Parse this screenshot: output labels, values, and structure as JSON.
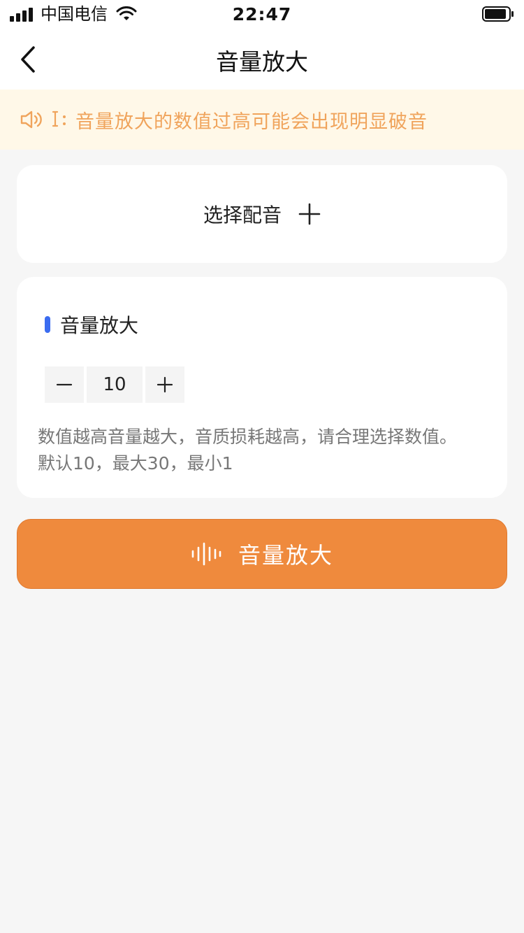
{
  "status_bar": {
    "carrier": "中国电信",
    "time": "22:47"
  },
  "nav": {
    "title": "音量放大"
  },
  "notice": {
    "text": "音量放大的数值过高可能会出现明显破音",
    "color": "#f0a45c"
  },
  "select_dub": {
    "label": "选择配音"
  },
  "amplify": {
    "section_title": "音量放大",
    "value": "10",
    "hint_line1": "数值越高音量越大，音质损耗越高，请合理选择数值。",
    "hint_line2": "默认10，最大30，最小1"
  },
  "action_button": {
    "label": "音量放大",
    "color": "#ef8a3d"
  },
  "icons": {
    "back": "chevron-left-icon",
    "speaker": "speaker-icon",
    "plus": "plus-icon",
    "minus": "minus-icon",
    "wave": "sound-wave-icon"
  }
}
